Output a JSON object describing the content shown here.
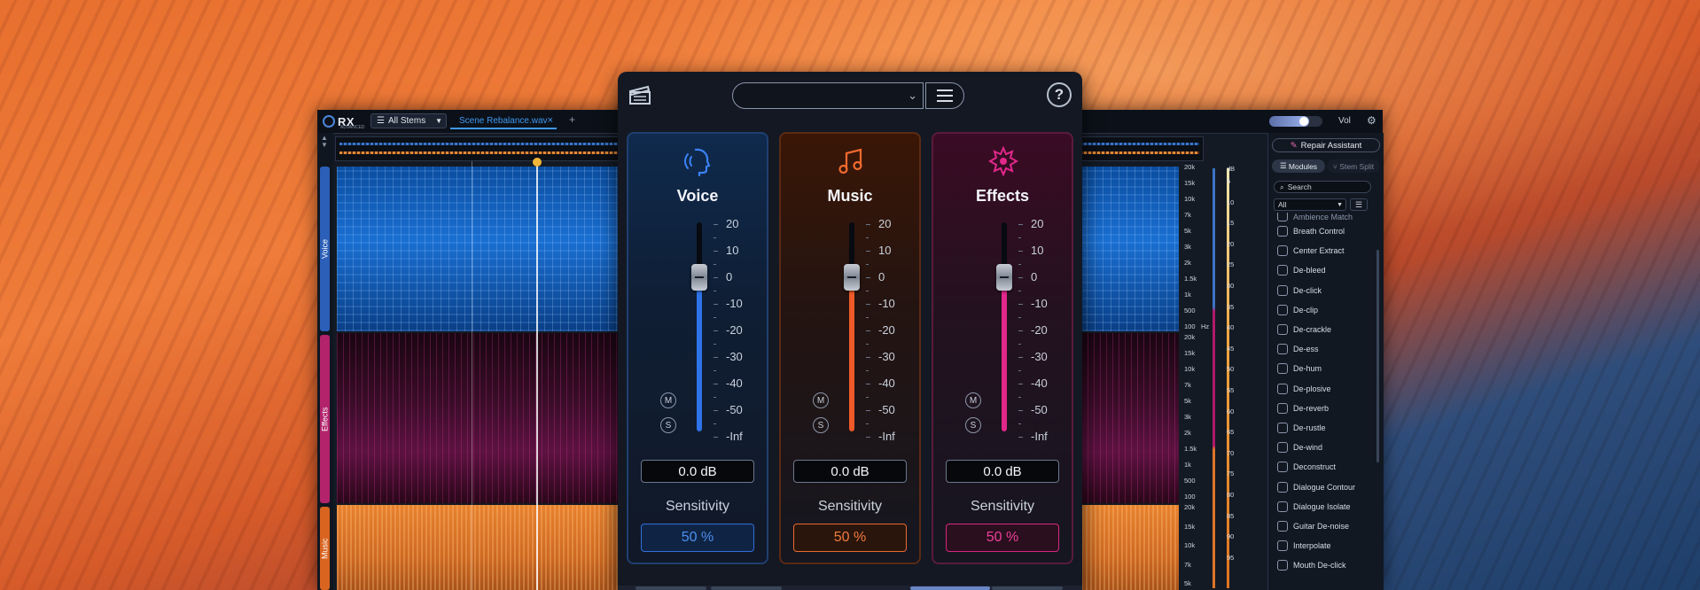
{
  "colors": {
    "voice": "#2f73e8",
    "music": "#ef5a28",
    "effects": "#e2278a",
    "accent_link": "#3f98f0"
  },
  "rx": {
    "logo": "RX",
    "logo_sub": "ADVANCED",
    "stem_selector": "All Stems",
    "file_tab": "Scene Rebalance.wav",
    "add_tab": "+",
    "vol_label": "Vol",
    "vol_level": 0.75,
    "stem_labels": {
      "voice": "Voice",
      "effects": "Effects",
      "music": "Music"
    },
    "freq_labels_voice": [
      "20k",
      "15k",
      "10k",
      "7k",
      "5k",
      "3k",
      "2k",
      "1.5k",
      "1k",
      "500",
      "100"
    ],
    "freq_labels_effects": [
      "20k",
      "15k",
      "10k",
      "7k",
      "5k",
      "3k",
      "2k",
      "1.5k",
      "1k",
      "500",
      "100"
    ],
    "freq_labels_music": [
      "20k",
      "15k",
      "10k",
      "7k",
      "5k"
    ],
    "hz_unit": "Hz",
    "db_unit": "dB",
    "db_labels": [
      "5",
      "10",
      "15",
      "20",
      "25",
      "30",
      "35",
      "40",
      "45",
      "50",
      "55",
      "60",
      "65",
      "70",
      "75",
      "80",
      "85",
      "90",
      "95"
    ]
  },
  "modules": {
    "repair_assistant": "Repair Assistant",
    "tab_modules": "Modules",
    "tab_stem_split": "Stem Split",
    "search_placeholder": "Search",
    "filter_value": "All",
    "items_cut": "Ambience Match",
    "items": [
      "Breath Control",
      "Center Extract",
      "De-bleed",
      "De-click",
      "De-clip",
      "De-crackle",
      "De-ess",
      "De-hum",
      "De-plosive",
      "De-reverb",
      "De-rustle",
      "De-wind",
      "Deconstruct",
      "Dialogue Contour",
      "Dialogue Isolate",
      "Guitar De-noise",
      "Interpolate",
      "Mouth De-click"
    ]
  },
  "plugin": {
    "preset_value": "",
    "scale_labels": [
      "20",
      "10",
      "0",
      "-10",
      "-20",
      "-30",
      "-40",
      "-50",
      "-Inf"
    ],
    "mute_label": "M",
    "solo_label": "S",
    "sensitivity_label": "Sensitivity",
    "strips": [
      {
        "title": "Voice",
        "gain": "0.0 dB",
        "sensitivity": "50 %",
        "fader_level_db": 0
      },
      {
        "title": "Music",
        "gain": "0.0 dB",
        "sensitivity": "50 %",
        "fader_level_db": 0
      },
      {
        "title": "Effects",
        "gain": "0.0 dB",
        "sensitivity": "50 %",
        "fader_level_db": 0
      }
    ]
  }
}
